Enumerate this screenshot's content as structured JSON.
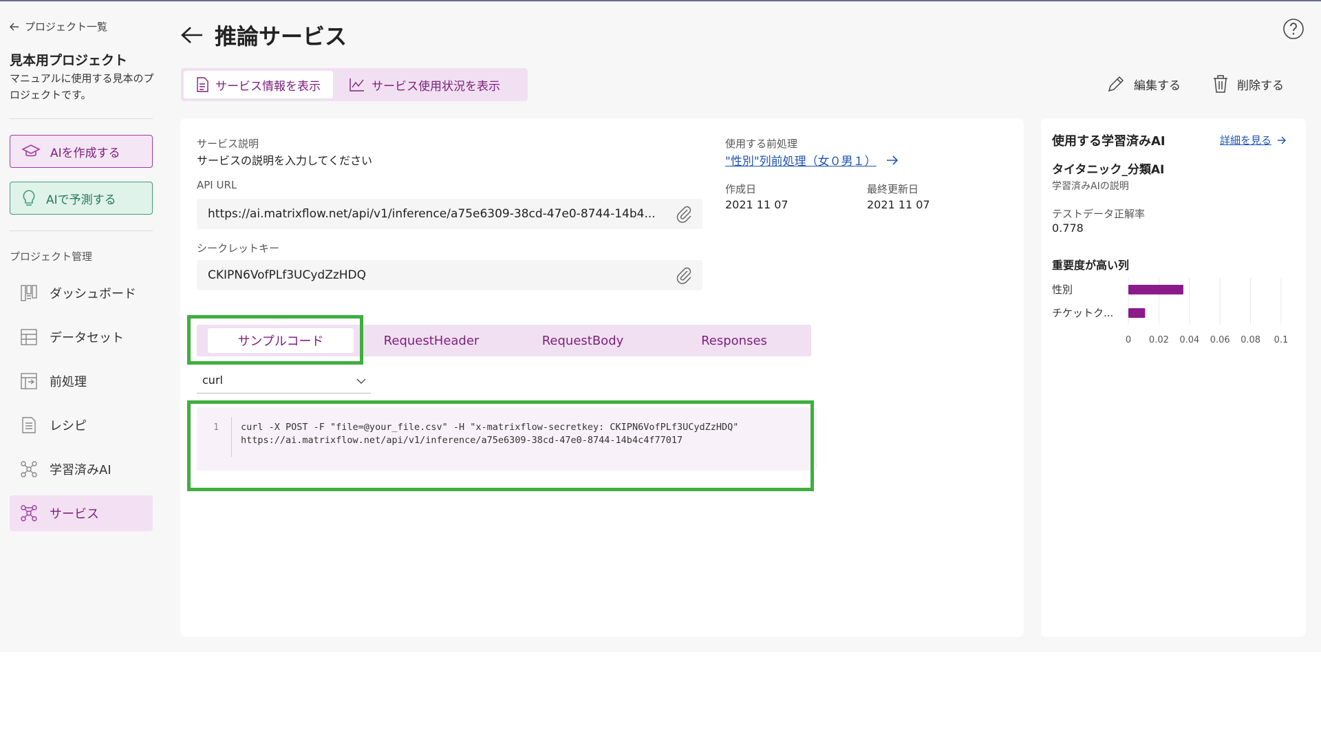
{
  "sidebar": {
    "back_label": "プロジェクト一覧",
    "project_title": "見本用プロジェクト",
    "project_desc": "マニュアルに使用する見本のプロジェクトです。",
    "create_ai": "AIを作成する",
    "predict_ai": "AIで予測する",
    "section_label": "プロジェクト管理",
    "nav": [
      {
        "label": "ダッシュボード",
        "icon": "dashboard-icon"
      },
      {
        "label": "データセット",
        "icon": "dataset-icon"
      },
      {
        "label": "前処理",
        "icon": "preprocess-icon"
      },
      {
        "label": "レシピ",
        "icon": "recipe-icon"
      },
      {
        "label": "学習済みAI",
        "icon": "trained-ai-icon"
      },
      {
        "label": "サービス",
        "icon": "service-icon"
      }
    ]
  },
  "header": {
    "title": "推論サービス",
    "view_tabs": [
      "サービス情報を表示",
      "サービス使用状況を表示"
    ],
    "edit_label": "編集する",
    "delete_label": "削除する"
  },
  "service": {
    "desc_label": "サービス説明",
    "desc_value": "サービスの説明を入力してください",
    "api_url_label": "API URL",
    "api_url": "https://ai.matrixflow.net/api/v1/inference/a75e6309-38cd-47e0-8744-14b4...",
    "secret_label": "シークレットキー",
    "secret": "CKIPN6VofPLf3UCydZzHDQ",
    "preprocess_label": "使用する前処理",
    "preprocess_link": "\"性別\"列前処理（女０男１）",
    "created_label": "作成日",
    "created": "2021 11 07",
    "updated_label": "最終更新日",
    "updated": "2021 11 07"
  },
  "code_tabs": [
    "サンプルコード",
    "RequestHeader",
    "RequestBody",
    "Responses"
  ],
  "lang_select": "curl",
  "code": {
    "line_no": "1",
    "text": "curl -X POST -F \"file=@your_file.csv\" -H \"x-matrixflow-secretkey: CKIPN6VofPLf3UCydZzHDQ\"\nhttps://ai.matrixflow.net/api/v1/inference/a75e6309-38cd-47e0-8744-14b4c4f77017"
  },
  "side": {
    "title": "使用する学習済みAI",
    "detail_link": "詳細を見る",
    "ai_name": "タイタニック_分類AI",
    "ai_desc": "学習済みAIの説明",
    "acc_label": "テストデータ正解率",
    "acc_value": "0.778",
    "chart_title": "重要度が高い列"
  },
  "chart_data": {
    "type": "bar",
    "orientation": "horizontal",
    "title": "重要度が高い列",
    "categories": [
      "性別",
      "チケットク..."
    ],
    "values": [
      0.036,
      0.011
    ],
    "xlim": [
      0,
      0.1
    ],
    "xticks": [
      "0",
      "0.02",
      "0.04",
      "0.06",
      "0.08",
      "0.1"
    ],
    "bar_color": "#8b1a8b",
    "grid": true
  },
  "colors": {
    "accent": "#7d1f7d",
    "highlight": "#3fae3f",
    "link": "#1f53b5",
    "predict_green": "#24795a"
  }
}
